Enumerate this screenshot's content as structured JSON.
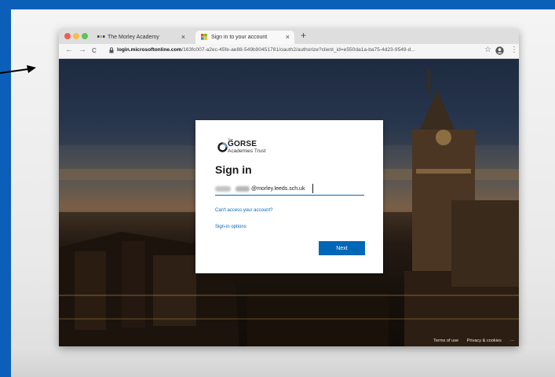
{
  "browser": {
    "tabs": [
      {
        "label": "The Morley Academy",
        "close": "×"
      },
      {
        "label": "Sign in to your account",
        "close": "×"
      }
    ],
    "new_tab": "+",
    "nav": {
      "back": "←",
      "forward": "→",
      "reload": "C"
    },
    "url": {
      "host": "login.microsoftonline.com",
      "path": "/163fc007-a2ec-45fe-ae88-549b90451781/oauth2/authorize?client_id=e550da1a-ba75-4d23-9549-d..."
    },
    "star": "☆",
    "menu": "⋮",
    "colors": {
      "chrome": "#dedede",
      "active_tab": "#f8f8f8"
    }
  },
  "logo": {
    "the": "The",
    "name": "GORSE",
    "sub": "Academies Trust"
  },
  "signin": {
    "title": "Sign in",
    "email_domain": "@morley.leeds.sch.uk",
    "cant_access": "Can't access your account?",
    "signin_options": "Sign-in options",
    "next": "Next",
    "colors": {
      "accent": "#0067b8"
    }
  },
  "footer": {
    "terms": "Terms of use",
    "privacy": "Privacy & cookies",
    "more": "···"
  },
  "icons": [
    "arrow-right-icon",
    "lock-icon",
    "star-icon",
    "profile-icon",
    "menu-icon",
    "microsoft-icon",
    "gorse-logo-icon"
  ]
}
